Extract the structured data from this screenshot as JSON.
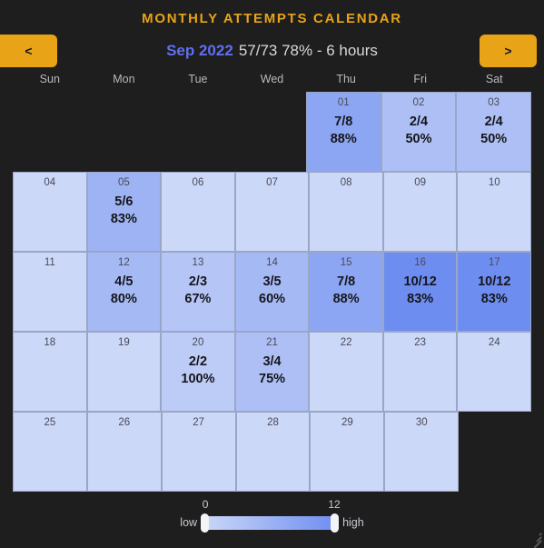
{
  "window": {
    "title": "MONTHLY ATTEMPTS CALENDAR",
    "background": "#1e1e1e",
    "accent": "#e8a317",
    "month_color": "#5f6ff0"
  },
  "nav": {
    "prev_label": "<",
    "next_label": ">",
    "month": "Sep 2022",
    "summary": "57/73 78% - 6 hours"
  },
  "weekdays": [
    "Sun",
    "Mon",
    "Tue",
    "Wed",
    "Thu",
    "Fri",
    "Sat"
  ],
  "legend": {
    "low_label": "low",
    "high_label": "high",
    "min_tick": "0",
    "max_tick": "12",
    "min_color": "#ccd8f8",
    "max_color": "#6e8df0"
  },
  "chart_data": {
    "type": "heatmap",
    "title": "MONTHLY ATTEMPTS CALENDAR",
    "subtitle": "Sep 2022 57/73 78% - 6 hours",
    "value_label": "attempts",
    "colorbar": {
      "min": 0,
      "max": 12,
      "min_label": "low",
      "max_label": "high"
    },
    "columns": [
      "Sun",
      "Mon",
      "Tue",
      "Wed",
      "Thu",
      "Fri",
      "Sat"
    ],
    "totals": {
      "made": 57,
      "attempts": 73,
      "percent": "78%",
      "hours": "6 hours"
    },
    "weeks": [
      [
        {
          "blank": true
        },
        {
          "blank": true
        },
        {
          "blank": true
        },
        {
          "blank": true
        },
        {
          "day": "01",
          "made": 7,
          "attempts": 8,
          "ratio": "7/8",
          "percent": "88%"
        },
        {
          "day": "02",
          "made": 2,
          "attempts": 4,
          "ratio": "2/4",
          "percent": "50%"
        },
        {
          "day": "03",
          "made": 2,
          "attempts": 4,
          "ratio": "2/4",
          "percent": "50%"
        }
      ],
      [
        {
          "day": "04",
          "attempts": 0,
          "ratio": "",
          "percent": ""
        },
        {
          "day": "05",
          "made": 5,
          "attempts": 6,
          "ratio": "5/6",
          "percent": "83%"
        },
        {
          "day": "06",
          "attempts": 0,
          "ratio": "",
          "percent": ""
        },
        {
          "day": "07",
          "attempts": 0,
          "ratio": "",
          "percent": ""
        },
        {
          "day": "08",
          "attempts": 0,
          "ratio": "",
          "percent": ""
        },
        {
          "day": "09",
          "attempts": 0,
          "ratio": "",
          "percent": ""
        },
        {
          "day": "10",
          "attempts": 0,
          "ratio": "",
          "percent": ""
        }
      ],
      [
        {
          "day": "11",
          "attempts": 0,
          "ratio": "",
          "percent": ""
        },
        {
          "day": "12",
          "made": 4,
          "attempts": 5,
          "ratio": "4/5",
          "percent": "80%"
        },
        {
          "day": "13",
          "made": 2,
          "attempts": 3,
          "ratio": "2/3",
          "percent": "67%"
        },
        {
          "day": "14",
          "made": 3,
          "attempts": 5,
          "ratio": "3/5",
          "percent": "60%"
        },
        {
          "day": "15",
          "made": 7,
          "attempts": 8,
          "ratio": "7/8",
          "percent": "88%"
        },
        {
          "day": "16",
          "made": 10,
          "attempts": 12,
          "ratio": "10/12",
          "percent": "83%"
        },
        {
          "day": "17",
          "made": 10,
          "attempts": 12,
          "ratio": "10/12",
          "percent": "83%"
        }
      ],
      [
        {
          "day": "18",
          "attempts": 0,
          "ratio": "",
          "percent": ""
        },
        {
          "day": "19",
          "attempts": 0,
          "ratio": "",
          "percent": ""
        },
        {
          "day": "20",
          "made": 2,
          "attempts": 2,
          "ratio": "2/2",
          "percent": "100%"
        },
        {
          "day": "21",
          "made": 3,
          "attempts": 4,
          "ratio": "3/4",
          "percent": "75%"
        },
        {
          "day": "22",
          "attempts": 0,
          "ratio": "",
          "percent": ""
        },
        {
          "day": "23",
          "attempts": 0,
          "ratio": "",
          "percent": ""
        },
        {
          "day": "24",
          "attempts": 0,
          "ratio": "",
          "percent": ""
        }
      ],
      [
        {
          "day": "25",
          "attempts": 0,
          "ratio": "",
          "percent": ""
        },
        {
          "day": "26",
          "attempts": 0,
          "ratio": "",
          "percent": ""
        },
        {
          "day": "27",
          "attempts": 0,
          "ratio": "",
          "percent": ""
        },
        {
          "day": "28",
          "attempts": 0,
          "ratio": "",
          "percent": ""
        },
        {
          "day": "29",
          "attempts": 0,
          "ratio": "",
          "percent": ""
        },
        {
          "day": "30",
          "attempts": 0,
          "ratio": "",
          "percent": ""
        },
        {
          "blank": true
        }
      ]
    ]
  }
}
